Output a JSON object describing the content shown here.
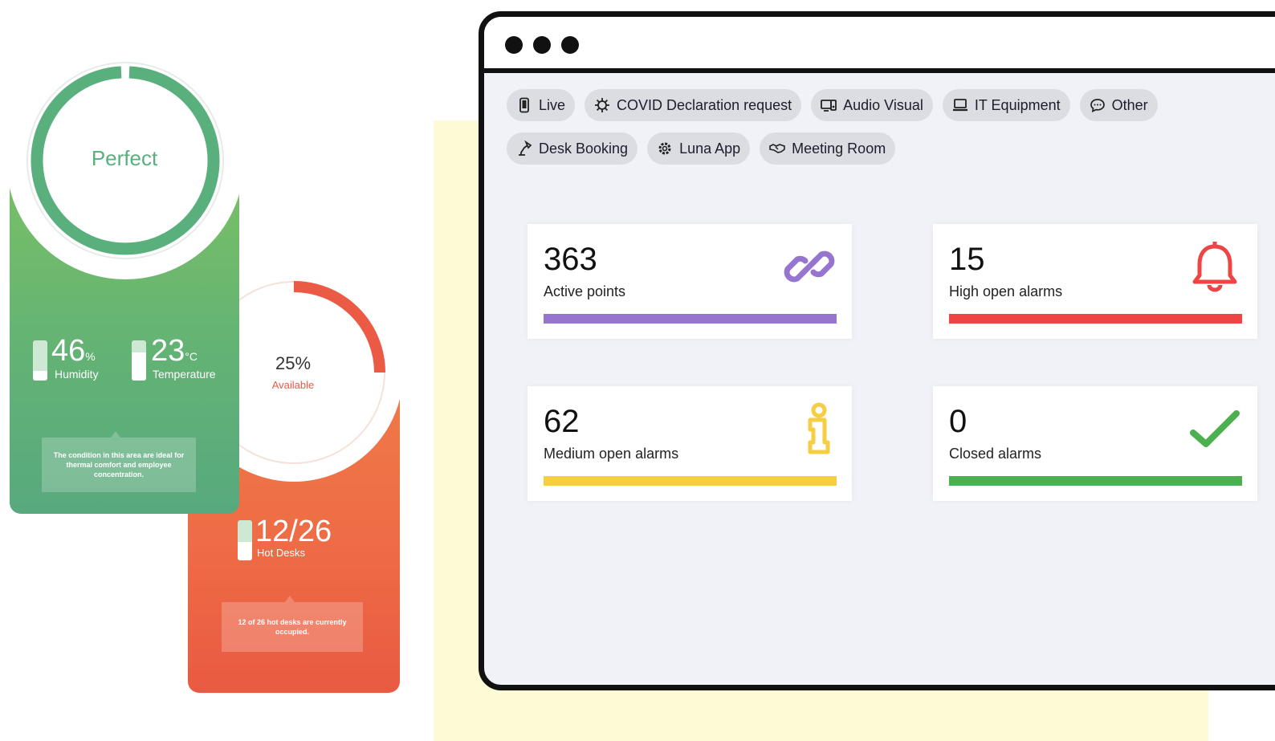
{
  "colors": {
    "green": "#62b276",
    "orange": "#ee6a45",
    "purple": "#9575cd",
    "red": "#ef4444",
    "yellow": "#f6ce42",
    "check_green": "#4caf50"
  },
  "environment_widget": {
    "status": "Perfect",
    "humidity": {
      "value": "46",
      "unit": "%",
      "label": "Humidity"
    },
    "temperature": {
      "value": "23",
      "unit": "°C",
      "label": "Temperature"
    },
    "message": "The condition in this area are ideal for thermal comfort and employee concentration."
  },
  "desk_widget": {
    "percent": "25%",
    "percent_label": "Available",
    "availability_fraction": 0.25,
    "hot_desks": {
      "value": "12/26",
      "label": "Hot Desks"
    },
    "message": "12 of 26 hot desks are currently occupied."
  },
  "dashboard": {
    "chips": [
      {
        "label": "Live",
        "icon": "phone-icon"
      },
      {
        "label": "COVID Declaration request",
        "icon": "virus-icon"
      },
      {
        "label": "Audio Visual",
        "icon": "audio-visual-icon"
      },
      {
        "label": "IT Equipment",
        "icon": "laptop-icon"
      },
      {
        "label": "Other",
        "icon": "chat-bubble-icon"
      },
      {
        "label": "Desk Booking",
        "icon": "desk-lamp-icon"
      },
      {
        "label": "Luna App",
        "icon": "gear-icon"
      },
      {
        "label": "Meeting Room",
        "icon": "handshake-icon"
      }
    ],
    "cards": [
      {
        "value": "363",
        "label": "Active points",
        "icon": "link-icon",
        "color": "#9575cd"
      },
      {
        "value": "15",
        "label": "High open alarms",
        "icon": "bell-icon",
        "color": "#ef4444"
      },
      {
        "value": "62",
        "label": "Medium open alarms",
        "icon": "info-icon",
        "color": "#f6ce42"
      },
      {
        "value": "0",
        "label": "Closed alarms",
        "icon": "check-icon",
        "color": "#4caf50"
      }
    ]
  }
}
